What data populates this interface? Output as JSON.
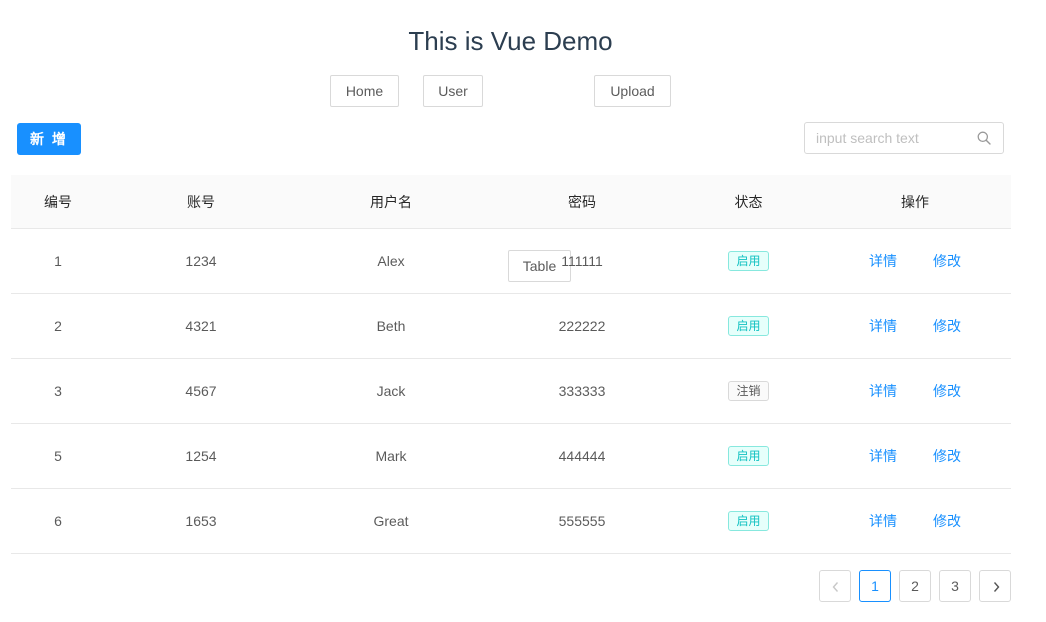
{
  "header": {
    "title": "This is Vue Demo",
    "nav": [
      "Home",
      "User",
      "Table",
      "Upload"
    ]
  },
  "toolbar": {
    "add_label": "新 增",
    "search_placeholder": "input search text",
    "search_icon": "search-icon"
  },
  "table": {
    "columns": [
      "编号",
      "账号",
      "用户名",
      "密码",
      "状态",
      "操作"
    ],
    "rows": [
      {
        "id": "1",
        "account": "1234",
        "username": "Alex",
        "password": "111111",
        "status": "启用",
        "status_type": "enabled"
      },
      {
        "id": "2",
        "account": "4321",
        "username": "Beth",
        "password": "222222",
        "status": "启用",
        "status_type": "enabled"
      },
      {
        "id": "3",
        "account": "4567",
        "username": "Jack",
        "password": "333333",
        "status": "注销",
        "status_type": "cancelled"
      },
      {
        "id": "5",
        "account": "1254",
        "username": "Mark",
        "password": "444444",
        "status": "启用",
        "status_type": "enabled"
      },
      {
        "id": "6",
        "account": "1653",
        "username": "Great",
        "password": "555555",
        "status": "启用",
        "status_type": "enabled"
      }
    ],
    "actions": {
      "detail": "详情",
      "edit": "修改"
    }
  },
  "pagination": {
    "pages": [
      "1",
      "2",
      "3"
    ],
    "current": "1"
  },
  "colors": {
    "primary": "#1890ff",
    "tag_enabled": "#13c2c2",
    "title": "#2c3e50"
  }
}
